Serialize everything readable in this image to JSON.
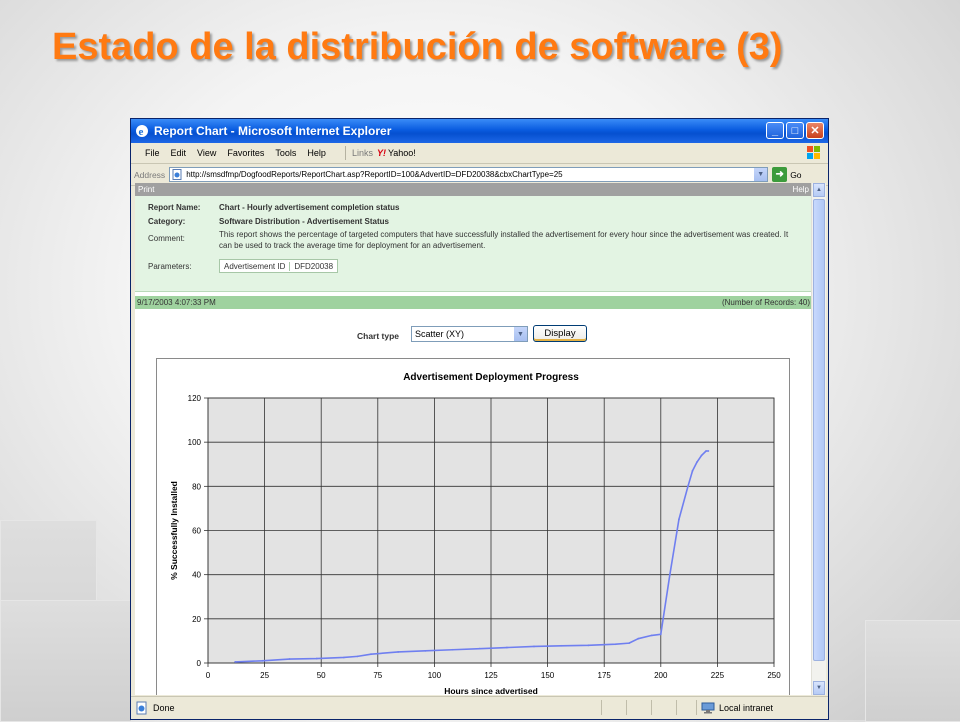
{
  "slide": {
    "title": "Estado de la distribución de software (3)",
    "title_color": "#ff7a12"
  },
  "window": {
    "title": "Report Chart - Microsoft Internet Explorer",
    "controls": {
      "minimize": "_",
      "maximize": "□",
      "close": "✕"
    },
    "menu": [
      "File",
      "Edit",
      "View",
      "Favorites",
      "Tools",
      "Help"
    ],
    "links_label": "Links",
    "links_item": "Yahoo!",
    "address_label": "Address",
    "address_url": "http://smsdfmp/DogfoodReports/ReportChart.asp?ReportID=100&AdvertID=DFD20038&cbxChartType=25",
    "go_label": "Go"
  },
  "report": {
    "print_label": "Print",
    "help_label": "Help",
    "fields": {
      "report_name_label": "Report Name:",
      "report_name": "Chart - Hourly advertisement completion status",
      "category_label": "Category:",
      "category": "Software Distribution - Advertisement Status",
      "comment_label": "Comment:",
      "comment": "This report shows the percentage of targeted computers that have successfully installed the advertisement for every hour since the advertisement was created. It can be used to track the average time for deployment for an advertisement.",
      "parameters_label": "Parameters:",
      "param_name": "Advertisement ID",
      "param_value": "DFD20038"
    },
    "timestamp": "9/17/2003 4:07:33 PM",
    "record_count": "(Number of Records: 40)",
    "chart_type_label": "Chart type",
    "chart_type_value": "Scatter (XY)",
    "display_button": "Display"
  },
  "status_bar": {
    "text": "Done",
    "zone": "Local intranet"
  },
  "chart_data": {
    "type": "line",
    "title": "Advertisement Deployment Progress",
    "xlabel": "Hours since advertised",
    "ylabel": "% Successfully Installed",
    "xlim": [
      0,
      250
    ],
    "ylim": [
      0,
      120
    ],
    "xticks": [
      0,
      25,
      50,
      75,
      100,
      125,
      150,
      175,
      200,
      225,
      250
    ],
    "yticks": [
      0,
      20,
      40,
      60,
      80,
      100,
      120
    ],
    "grid": true,
    "plot_background": "#e3e3e3",
    "line_color": "#6f7ff0",
    "series": [
      {
        "x": [
          12,
          24,
          36,
          48,
          60,
          66,
          72,
          84,
          96,
          108,
          120,
          132,
          144,
          156,
          168,
          180,
          186,
          190,
          196,
          200,
          204,
          208,
          212,
          214,
          216,
          218,
          220,
          221
        ],
        "y": [
          0.5,
          1,
          1.8,
          2,
          2.5,
          3,
          4,
          5,
          5.5,
          6,
          6.5,
          7,
          7.5,
          7.8,
          8,
          8.5,
          9,
          11,
          12.5,
          13,
          40,
          65,
          80,
          87,
          91,
          94,
          96,
          96
        ]
      }
    ]
  }
}
